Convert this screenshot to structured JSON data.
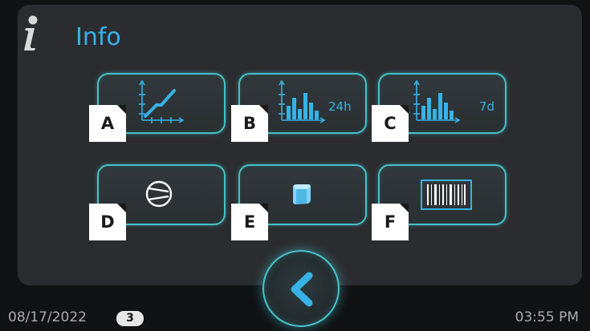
{
  "header": {
    "icon": "info-icon",
    "title": "Info"
  },
  "tiles": [
    {
      "key": "A",
      "icon": "line-graph-icon"
    },
    {
      "key": "B",
      "icon": "bar-chart-icon",
      "suffix": "24h"
    },
    {
      "key": "C",
      "icon": "bar-chart-icon",
      "suffix": "7d"
    },
    {
      "key": "D",
      "icon": "compressor-icon"
    },
    {
      "key": "E",
      "icon": "ice-cube-icon"
    },
    {
      "key": "F",
      "icon": "barcode-icon"
    }
  ],
  "back_button": {
    "icon": "chevron-left-icon"
  },
  "footer": {
    "date": "08/17/2022",
    "badge": "3",
    "time": "03:55 PM"
  },
  "colors": {
    "accent": "#36b2e6",
    "tile_border": "#45c2c8",
    "panel": "#2b2c2f",
    "background": "#111214"
  }
}
